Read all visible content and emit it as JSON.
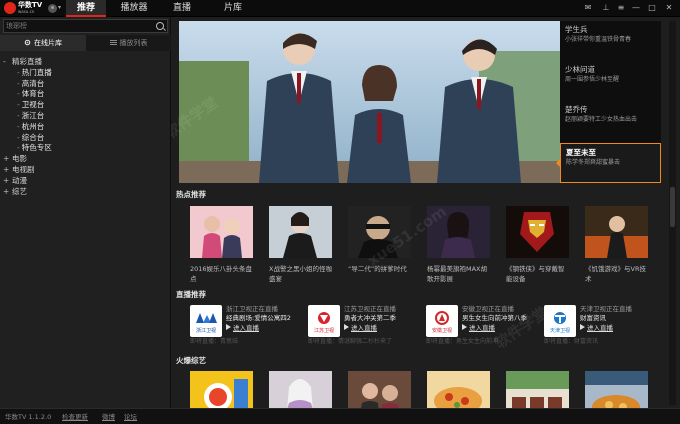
{
  "app": {
    "logo_text": "华数TV",
    "logo_sub": "wasu.cn",
    "version": "华数TV 1.1.2.0"
  },
  "nav": {
    "tabs": [
      "推荐",
      "播放器",
      "直播",
      "片库"
    ],
    "active": 0
  },
  "window_controls": [
    "feedback",
    "skin",
    "menu",
    "minimize",
    "maximize",
    "close"
  ],
  "search": {
    "placeholder": "琅琊榜"
  },
  "sidebar": {
    "tabs": [
      "在线片库",
      "播放列表"
    ],
    "tree": [
      {
        "label": "精彩直播",
        "toggle": "-",
        "level": 0
      },
      {
        "label": "热门直播",
        "level": 1
      },
      {
        "label": "高清台",
        "level": 1
      },
      {
        "label": "体育台",
        "level": 1
      },
      {
        "label": "卫视台",
        "level": 1
      },
      {
        "label": "浙江台",
        "level": 1
      },
      {
        "label": "杭州台",
        "level": 1
      },
      {
        "label": "综合台",
        "level": 1
      },
      {
        "label": "特色专区",
        "level": 1
      },
      {
        "label": "电影",
        "toggle": "+",
        "level": 0
      },
      {
        "label": "电视剧",
        "toggle": "+",
        "level": 0
      },
      {
        "label": "动漫",
        "toggle": "+",
        "level": 0
      },
      {
        "label": "综艺",
        "toggle": "+",
        "level": 0
      }
    ]
  },
  "status": {
    "check_update": "检查更新",
    "weibo": "微博",
    "forum": "论坛"
  },
  "featured": [
    {
      "title": "学生兵",
      "desc": "小张徉带你重温铁骨青春"
    },
    {
      "title": "少林问道",
      "desc": "周一围参悟少林至醒"
    },
    {
      "title": "楚乔传",
      "desc": "赵丽颖要特工少女热血出击"
    },
    {
      "title": "夏至未至",
      "desc": "陈学冬郑爽甜蜜暴击",
      "active": true
    }
  ],
  "sections": {
    "hot": "热点推荐",
    "live": "直播推荐",
    "variety": "火爆综艺"
  },
  "hot_items": [
    {
      "caption": "2016娱乐八卦头条盘点"
    },
    {
      "caption": "X战警之黑小姐的怪咖盛宴"
    },
    {
      "caption": "“导二代”的拼爹时代"
    },
    {
      "caption": "杨幂最美旗袍MAX胡歌开影展"
    },
    {
      "caption": "《钢铁侠》与穿戴智能设备"
    },
    {
      "caption": "《饥饿游戏》与VR技术"
    }
  ],
  "live_items": [
    {
      "channel": "浙江卫视正在直播",
      "show": "经典剧场:爱情公寓四2",
      "action": "进入直播",
      "next": "即将直播：青葱结",
      "logo": "浙江卫视",
      "color": "#1d56b0"
    },
    {
      "channel": "江苏卫视正在直播",
      "show": "勇者大冲关第二季",
      "action": "进入直播",
      "next": "即将直播：情谜聊强二杉杉来了",
      "logo": "江苏卫视",
      "color": "#d8232a"
    },
    {
      "channel": "安徽卫视正在直播",
      "show": "男生女生向前冲第八季",
      "action": "进入直播",
      "next": "即将直播：男生女生向前冲",
      "logo": "安徽卫视",
      "color": "#cf2a2a"
    },
    {
      "channel": "天津卫视正在直播",
      "show": "财富资讯",
      "action": "进入直播",
      "next": "即将直播：财富资讯",
      "logo": "天津卫视",
      "color": "#1a78c8"
    }
  ],
  "variety_items": [
    {
      "caption": ""
    },
    {
      "caption": ""
    },
    {
      "caption": ""
    },
    {
      "caption": ""
    },
    {
      "caption": ""
    },
    {
      "caption": ""
    }
  ],
  "watermark": [
    "软件学堂",
    "xue51.com"
  ]
}
